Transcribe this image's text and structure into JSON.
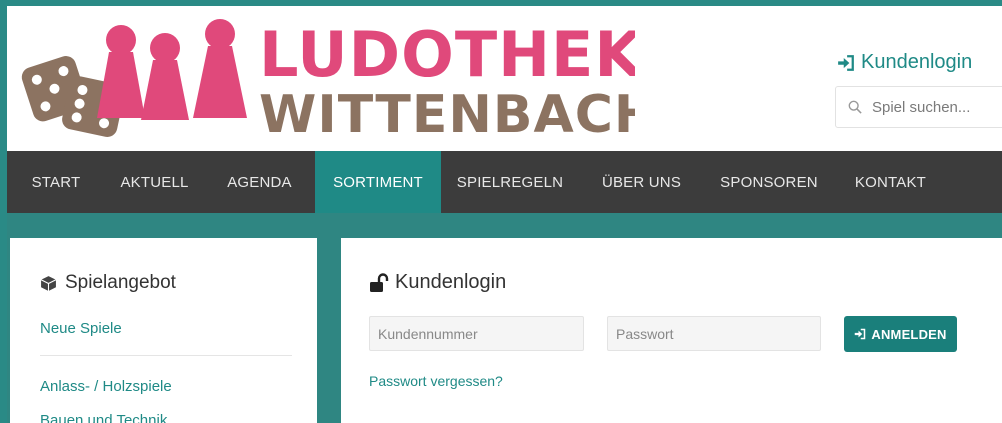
{
  "header": {
    "logo_line1": "LUDOTHEK",
    "logo_line2": "WITTENBACH",
    "login_link": "Kundenlogin",
    "search_placeholder": "Spiel suchen..."
  },
  "nav": {
    "items": [
      {
        "label": "START",
        "active": false
      },
      {
        "label": "AKTUELL",
        "active": false
      },
      {
        "label": "AGENDA",
        "active": false
      },
      {
        "label": "SORTIMENT",
        "active": true
      },
      {
        "label": "SPIELREGELN",
        "active": false
      },
      {
        "label": "ÜBER UNS",
        "active": false
      },
      {
        "label": "SPONSOREN",
        "active": false
      },
      {
        "label": "KONTAKT",
        "active": false
      }
    ]
  },
  "sidebar": {
    "title": "Spielangebot",
    "title_icon": "cube-icon",
    "new_games": "Neue Spiele",
    "categories": [
      "Anlass- / Holzspiele",
      "Bauen und Technik"
    ]
  },
  "main": {
    "title": "Kundenlogin",
    "title_icon": "unlock-icon",
    "customer_number_placeholder": "Kundennummer",
    "password_placeholder": "Passwort",
    "submit_label": "ANMELDEN",
    "forgot_label": "Passwort vergessen?"
  },
  "colors": {
    "teal": "#1f8a86",
    "pink": "#e0497b",
    "brown": "#8c7361",
    "nav_bg": "#3c3c3c"
  }
}
